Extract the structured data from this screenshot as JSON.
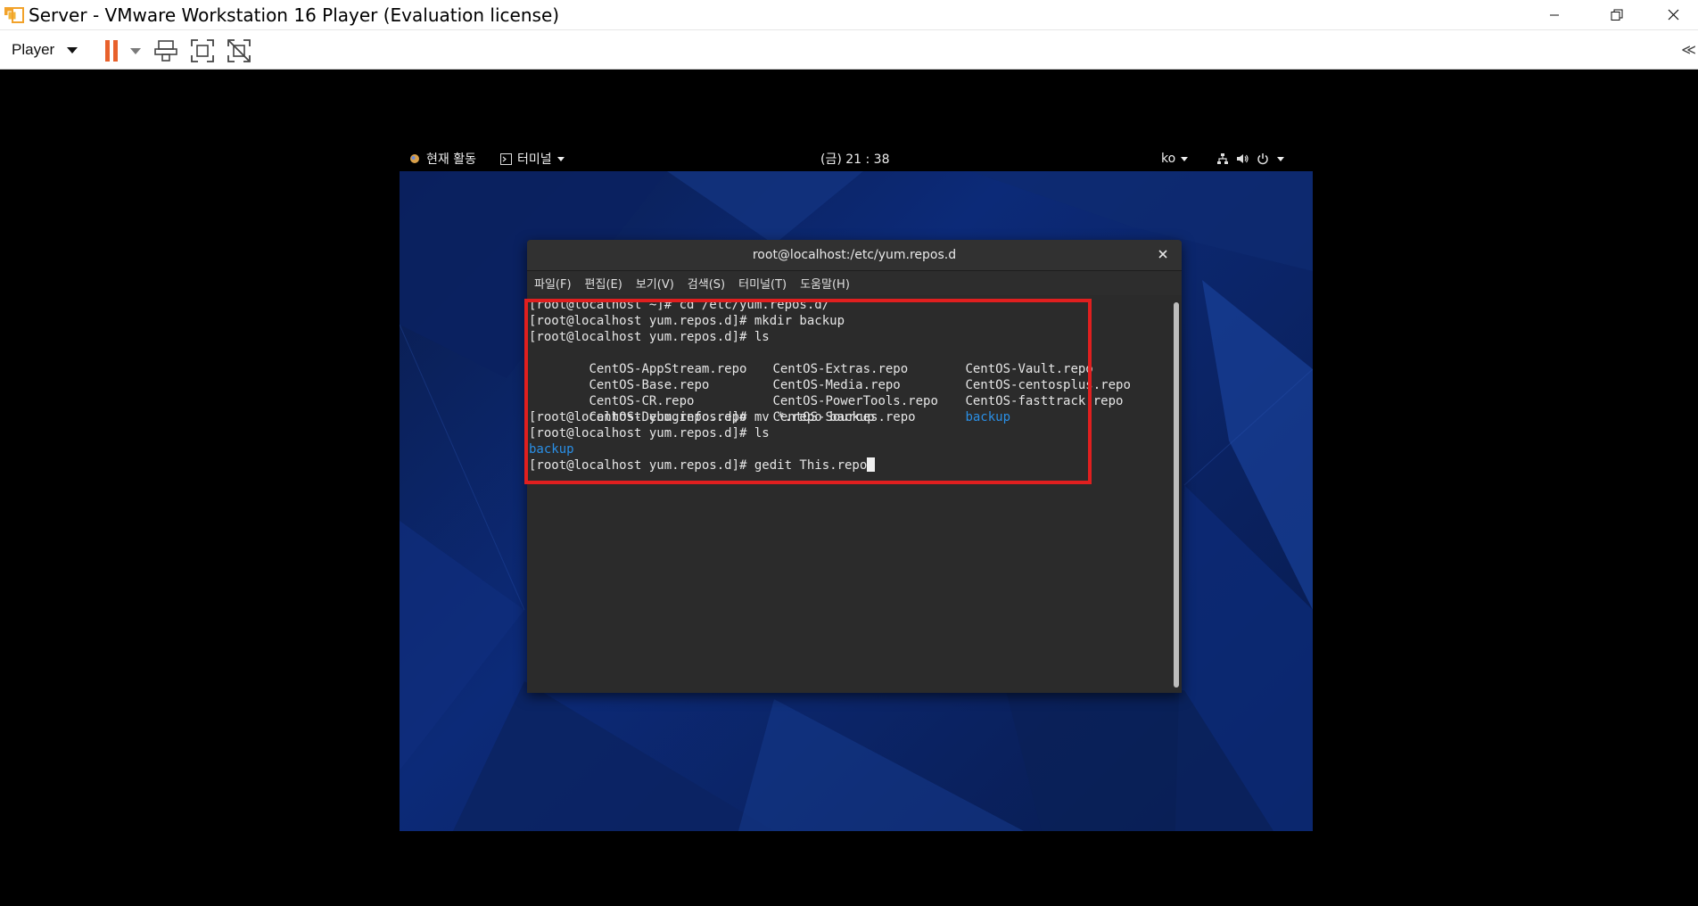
{
  "window": {
    "title": "Server - VMware Workstation 16 Player (Evaluation license)"
  },
  "toolbar": {
    "player_label": "Player",
    "icons": [
      "pause-icon",
      "send-ctrl-alt-del-icon",
      "fullscreen-icon",
      "unity-icon"
    ],
    "collapse_label": "≪"
  },
  "guest": {
    "topbar": {
      "activities": "현재 활동",
      "app_menu": "터미널",
      "clock": "(금) 21 : 38",
      "language": "ko"
    },
    "terminal": {
      "title": "root@localhost:/etc/yum.repos.d",
      "menu": [
        "파일(F)",
        "편집(E)",
        "보기(V)",
        "검색(S)",
        "터미널(T)",
        "도움말(H)"
      ],
      "lines": {
        "l1": "[root@localhost ~]# cd /etc/yum.repos.d/",
        "l2": "[root@localhost yum.repos.d]# mkdir backup",
        "l3": "[root@localhost yum.repos.d]# ls",
        "ls_row1": [
          "CentOS-AppStream.repo",
          "CentOS-Extras.repo",
          "CentOS-Vault.repo"
        ],
        "ls_row2": [
          "CentOS-Base.repo",
          "CentOS-Media.repo",
          "CentOS-centosplus.repo"
        ],
        "ls_row3": [
          "CentOS-CR.repo",
          "CentOS-PowerTools.repo",
          "CentOS-fasttrack.repo"
        ],
        "ls_row4": [
          "CentOS-Debuginfo.repo",
          "CentOS-Sources.repo",
          "backup"
        ],
        "l8": "[root@localhost yum.repos.d]# mv *.repo backup",
        "l9": "[root@localhost yum.repos.d]# ls",
        "l10": "backup",
        "l11": "[root@localhost yum.repos.d]# gedit This.repo"
      }
    }
  },
  "colors": {
    "highlight": "#e01f1f",
    "directory": "#2a8fe6",
    "pause": "#e8612c"
  }
}
